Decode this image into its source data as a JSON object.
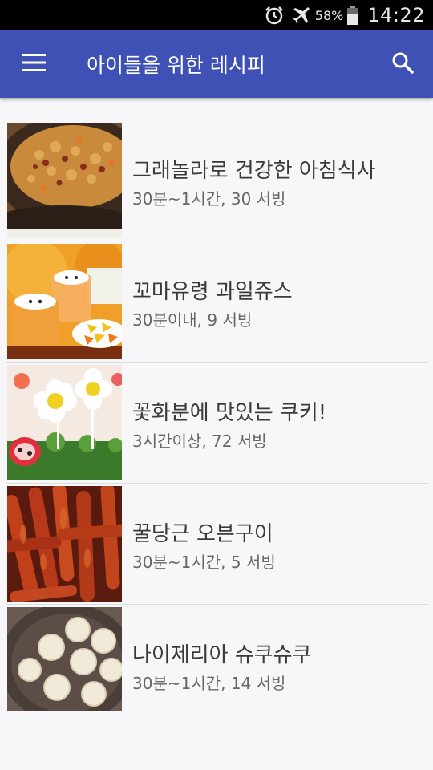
{
  "status_bar": {
    "battery_percent": "58%",
    "time": "14:22",
    "icons": [
      "alarm-icon",
      "airplane-mode-icon",
      "battery-icon"
    ]
  },
  "app_bar": {
    "title": "아이들을 위한 레시피",
    "menu_icon": "hamburger-menu-icon",
    "search_icon": "search-icon"
  },
  "colors": {
    "app_bar": "#3f51b5",
    "status_bar": "#000000",
    "background": "#f7f7f9"
  },
  "recipes": [
    {
      "title": "그래놀라로 건강한 아침식사",
      "meta": "30분~1시간, 30 서빙",
      "image": "granola-photo"
    },
    {
      "title": "꼬마유령 과일쥬스",
      "meta": "30분이내, 9 서빙",
      "image": "ghost-juice-photo"
    },
    {
      "title": "꽃화분에 맛있는 쿠키!",
      "meta": "3시간이상, 72 서빙",
      "image": "flower-cookie-photo"
    },
    {
      "title": "꿀당근 오븐구이",
      "meta": "30분~1시간, 5 서빙",
      "image": "roasted-carrot-photo"
    },
    {
      "title": "나이제리아 슈쿠슈쿠",
      "meta": "30분~1시간, 14 서빙",
      "image": "coconut-ball-photo"
    }
  ]
}
